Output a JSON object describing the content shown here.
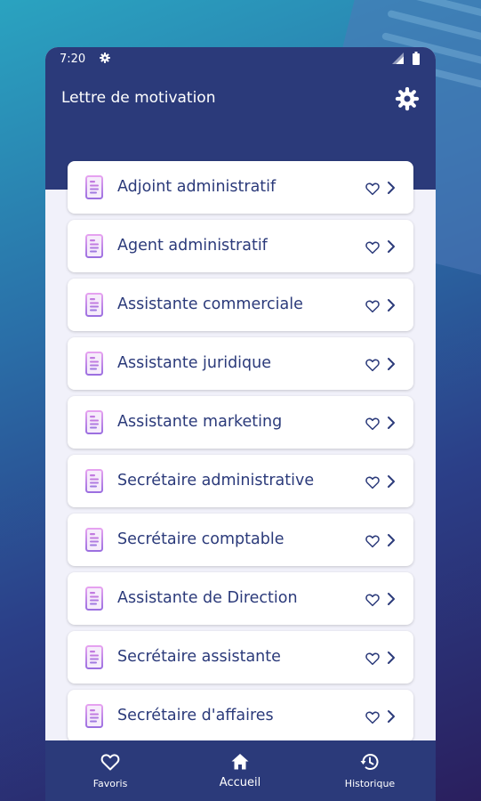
{
  "status_bar": {
    "time": "7:20"
  },
  "app_bar": {
    "title": "Lettre de motivation"
  },
  "list_items": [
    {
      "label": "Adjoint administratif"
    },
    {
      "label": "Agent administratif"
    },
    {
      "label": "Assistante commerciale"
    },
    {
      "label": "Assistante juridique"
    },
    {
      "label": "Assistante marketing"
    },
    {
      "label": "Secrétaire administrative"
    },
    {
      "label": "Secrétaire comptable"
    },
    {
      "label": "Assistante de Direction"
    },
    {
      "label": "Secrétaire assistante"
    },
    {
      "label": "Secrétaire d'affaires"
    }
  ],
  "bottom_nav": {
    "favorites": "Favoris",
    "home": "Accueil",
    "history": "Historique"
  },
  "colors": {
    "primary": "#2b3a7a",
    "background": "#f1f1fa",
    "card": "#ffffff",
    "accent": "#a24bd8"
  },
  "icons": [
    "settings-gear-icon",
    "document-icon",
    "heart-icon",
    "chevron-right-icon",
    "home-icon",
    "history-icon"
  ]
}
